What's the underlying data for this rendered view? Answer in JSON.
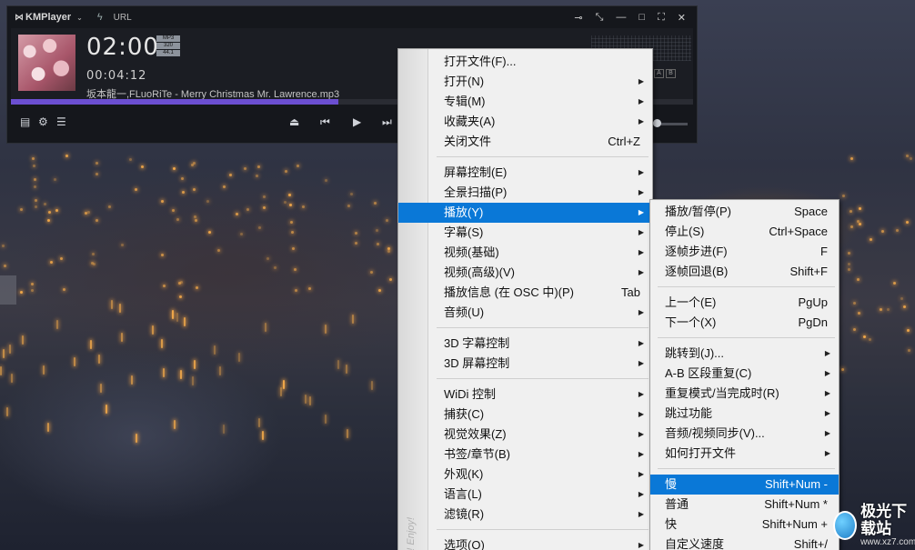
{
  "player": {
    "brand": "KMPlayer",
    "url_label": "URL",
    "time_display": "02:00",
    "elapsed": "00:04:12",
    "codec_tags": [
      "MP3",
      "320",
      "44.1"
    ],
    "filename": "坂本龍一,FLuoRiTe - Merry Christmas Mr. Lawrence.mp3",
    "progress_fraction": 0.48,
    "ab_labels": [
      "A",
      "B"
    ],
    "volume_fraction": 0.15,
    "icons": {
      "logo": "km-logo-icon",
      "dropdown": "caret-down-icon",
      "lightning": "lightning-icon",
      "pin": "pin-icon",
      "compact": "compact-icon",
      "minimize": "minimize-icon",
      "maximize": "maximize-icon",
      "fullscreen": "fullscreen-icon",
      "close": "close-icon",
      "playlist": "playlist-icon",
      "settings": "gear-icon",
      "menu": "menu-list-icon",
      "eject": "eject-icon",
      "prev": "previous-icon",
      "play": "play-icon",
      "next": "next-icon"
    },
    "accent": "#6b4fd1"
  },
  "main_menu": {
    "sidebar_text": "! Enjoy!",
    "groups": [
      [
        {
          "label": "打开文件(F)...",
          "shortcut": "",
          "submenu": false
        },
        {
          "label": "打开(N)",
          "shortcut": "",
          "submenu": true
        },
        {
          "label": "专辑(M)",
          "shortcut": "",
          "submenu": true
        },
        {
          "label": "收藏夹(A)",
          "shortcut": "",
          "submenu": true
        },
        {
          "label": "关闭文件",
          "shortcut": "Ctrl+Z",
          "submenu": false
        }
      ],
      [
        {
          "label": "屏幕控制(E)",
          "shortcut": "",
          "submenu": true
        },
        {
          "label": "全景扫描(P)",
          "shortcut": "",
          "submenu": true
        },
        {
          "label": "播放(Y)",
          "shortcut": "",
          "submenu": true,
          "highlighted": true
        },
        {
          "label": "字幕(S)",
          "shortcut": "",
          "submenu": true
        },
        {
          "label": "视频(基础)",
          "shortcut": "",
          "submenu": true
        },
        {
          "label": "视频(高级)(V)",
          "shortcut": "",
          "submenu": true
        },
        {
          "label": "播放信息 (在 OSC 中)(P)",
          "shortcut": "Tab",
          "submenu": false
        },
        {
          "label": "音频(U)",
          "shortcut": "",
          "submenu": true
        }
      ],
      [
        {
          "label": "3D 字幕控制",
          "shortcut": "",
          "submenu": true
        },
        {
          "label": "3D 屏幕控制",
          "shortcut": "",
          "submenu": true
        }
      ],
      [
        {
          "label": "WiDi 控制",
          "shortcut": "",
          "submenu": true
        },
        {
          "label": "捕获(C)",
          "shortcut": "",
          "submenu": true
        },
        {
          "label": "视觉效果(Z)",
          "shortcut": "",
          "submenu": true
        },
        {
          "label": "书签/章节(B)",
          "shortcut": "",
          "submenu": true
        },
        {
          "label": "外观(K)",
          "shortcut": "",
          "submenu": true
        },
        {
          "label": "语言(L)",
          "shortcut": "",
          "submenu": true
        },
        {
          "label": "滤镜(R)",
          "shortcut": "",
          "submenu": true
        }
      ],
      [
        {
          "label": "选项(O)",
          "shortcut": "",
          "submenu": true
        }
      ]
    ]
  },
  "play_submenu": {
    "groups": [
      [
        {
          "label": "播放/暂停(P)",
          "shortcut": "Space",
          "submenu": false
        },
        {
          "label": "停止(S)",
          "shortcut": "Ctrl+Space",
          "submenu": false
        },
        {
          "label": "逐帧步进(F)",
          "shortcut": "F",
          "submenu": false
        },
        {
          "label": "逐帧回退(B)",
          "shortcut": "Shift+F",
          "submenu": false
        }
      ],
      [
        {
          "label": "上一个(E)",
          "shortcut": "PgUp",
          "submenu": false
        },
        {
          "label": "下一个(X)",
          "shortcut": "PgDn",
          "submenu": false
        }
      ],
      [
        {
          "label": "跳转到(J)...",
          "shortcut": "",
          "submenu": true
        },
        {
          "label": "A-B 区段重复(C)",
          "shortcut": "",
          "submenu": true
        },
        {
          "label": "重复模式/当完成时(R)",
          "shortcut": "",
          "submenu": true
        },
        {
          "label": "跳过功能",
          "shortcut": "",
          "submenu": true
        },
        {
          "label": "音频/视频同步(V)...",
          "shortcut": "",
          "submenu": true
        },
        {
          "label": "如何打开文件",
          "shortcut": "",
          "submenu": true
        }
      ],
      [
        {
          "label": "慢",
          "shortcut": "Shift+Num -",
          "submenu": false,
          "highlighted": true
        },
        {
          "label": "普通",
          "shortcut": "Shift+Num *",
          "submenu": false
        },
        {
          "label": "快",
          "shortcut": "Shift+Num +",
          "submenu": false
        },
        {
          "label": "自定义速度",
          "shortcut": "Shift+/",
          "submenu": false
        }
      ]
    ]
  },
  "watermark": {
    "title": "极光下载站",
    "url": "www.xz7.com"
  },
  "highlight_color": "#0a78d7"
}
